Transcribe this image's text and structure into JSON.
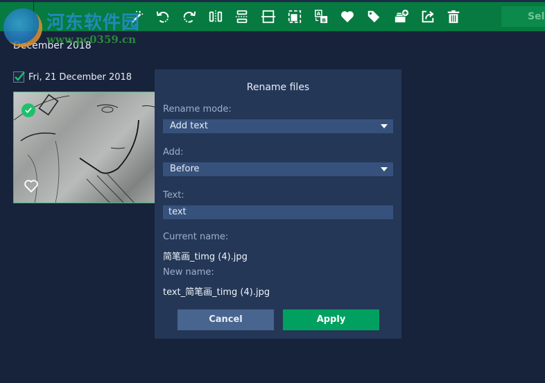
{
  "toolbar": {
    "buttons": [
      {
        "icon": "magic-wand-icon",
        "label": "Auto enhance"
      },
      {
        "icon": "rotate-left-icon",
        "label": "Rotate left"
      },
      {
        "icon": "rotate-right-icon",
        "label": "Rotate right"
      },
      {
        "icon": "flip-horizontal-icon",
        "label": "Flip horizontal"
      },
      {
        "icon": "flip-vertical-icon",
        "label": "Flip vertical"
      },
      {
        "icon": "crop-icon",
        "label": "Crop"
      },
      {
        "icon": "resize-icon",
        "label": "Resize"
      },
      {
        "icon": "rename-icon",
        "label": "Rename"
      },
      {
        "icon": "heart-icon",
        "label": "Favorite"
      },
      {
        "icon": "tag-icon",
        "label": "Tag"
      },
      {
        "icon": "add-to-album-icon",
        "label": "Add to album"
      },
      {
        "icon": "share-icon",
        "label": "Share"
      },
      {
        "icon": "trash-icon",
        "label": "Delete"
      }
    ],
    "select_label": "Select"
  },
  "watermark": {
    "site_name": "河东软件园",
    "url": "www.pc0359.cn"
  },
  "gallery": {
    "section_title": "December 2018",
    "day_label": "Fri, 21 December 2018",
    "day_checked": true,
    "thumbnail": {
      "selected": true,
      "favorite": false
    }
  },
  "dialog": {
    "title": "Rename files",
    "rename_mode_label": "Rename mode:",
    "rename_mode_value": "Add text",
    "add_label": "Add:",
    "add_value": "Before",
    "text_label": "Text:",
    "text_value": "text",
    "current_name_label": "Current name:",
    "current_name_value": "简笔画_timg (4).jpg",
    "new_name_label": "New name:",
    "new_name_value": "text_简笔画_timg (4).jpg",
    "cancel_label": "Cancel",
    "apply_label": "Apply"
  },
  "colors": {
    "toolbar_green": "#067a40",
    "apply_green": "#00a160",
    "cancel_blue": "#48658f",
    "dialog_bg": "#243757",
    "app_bg": "#17233b"
  }
}
